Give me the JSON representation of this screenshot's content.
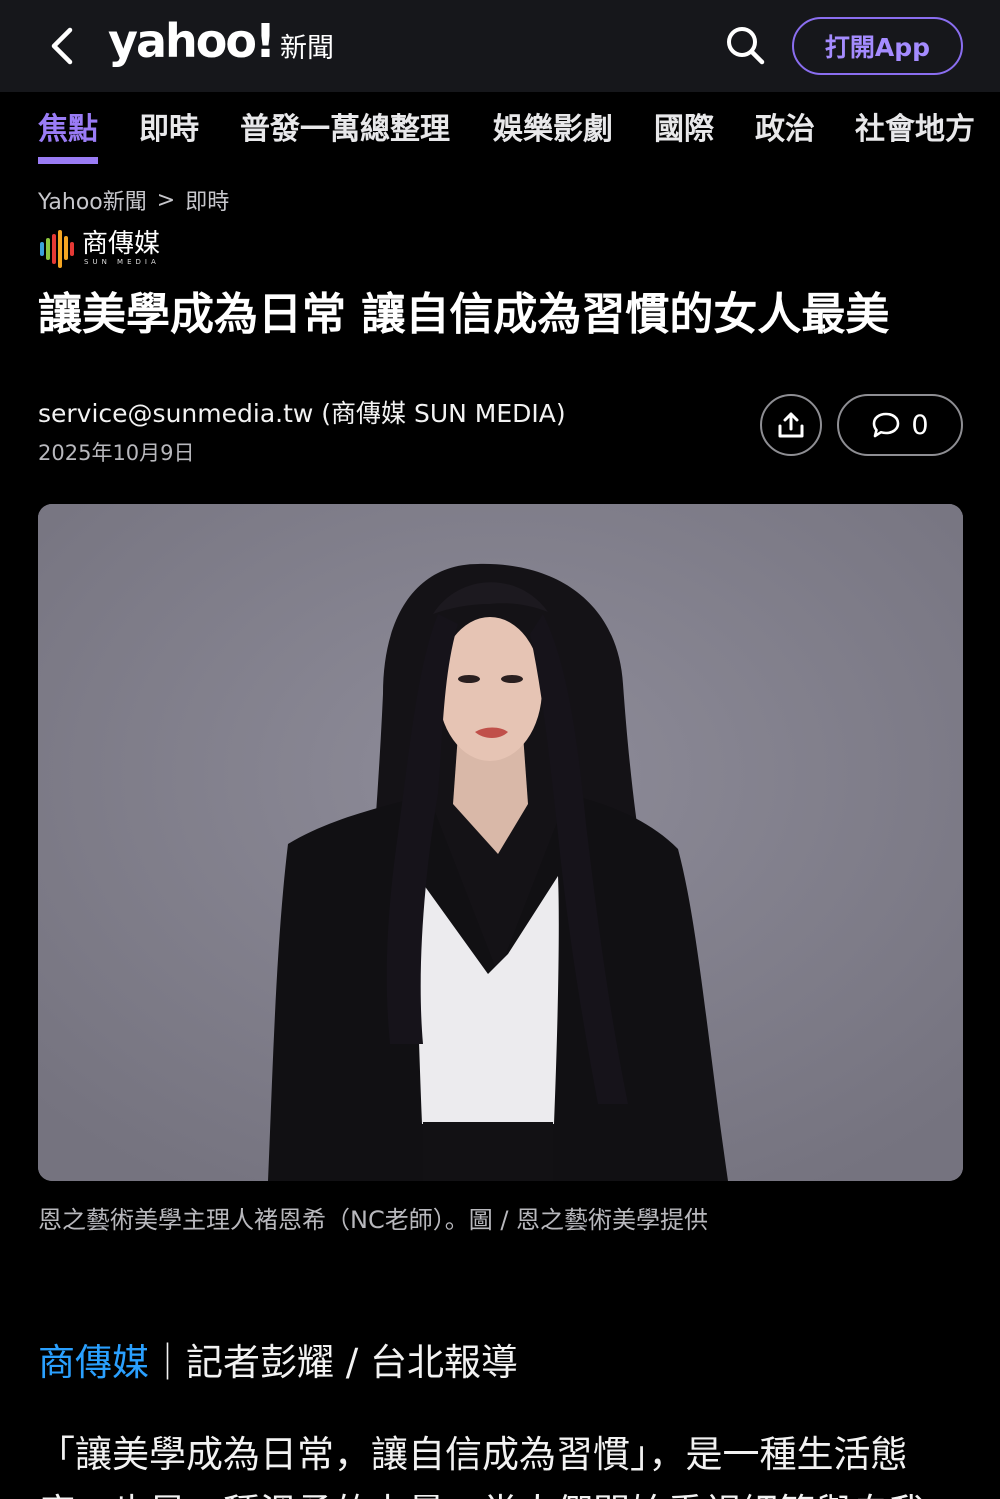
{
  "header": {
    "logo_word": "yahoo!",
    "logo_sub": "新聞",
    "open_app_label": "打開App",
    "back_icon": "chevron-left-icon",
    "search_icon": "search-icon"
  },
  "nav_tabs": [
    {
      "label": "焦點",
      "active": true
    },
    {
      "label": "即時",
      "active": false
    },
    {
      "label": "普發一萬總整理",
      "active": false
    },
    {
      "label": "娛樂影劇",
      "active": false
    },
    {
      "label": "國際",
      "active": false
    },
    {
      "label": "政治",
      "active": false
    },
    {
      "label": "社會地方",
      "active": false
    }
  ],
  "breadcrumb": {
    "home": "Yahoo新聞",
    "separator": ">",
    "current": "即時"
  },
  "source": {
    "name": "商傳媒",
    "sub": "SUN MEDIA"
  },
  "article": {
    "headline": "讓美學成為日常 讓自信成為習慣的女人最美",
    "author": "service@sunmedia.tw (商傳媒 SUN MEDIA)",
    "date": "2025年10月9日",
    "comment_count": "0",
    "photo_caption": "恩之藝術美學主理人褚恩希（NC老師）。圖 / 恩之藝術美學提供",
    "byline_source": "商傳媒",
    "byline_rest": "｜記者彭耀 / 台北報導",
    "body_first": "「讓美學成為日常，讓自信成為習慣」，是一種生活態度，也是一種溫柔的力量。當人們開始重視細節與自我"
  },
  "colors": {
    "accent": "#9a7cf5",
    "topbar_bg": "#16171b",
    "link_blue": "#2aa0ff",
    "photo_bg": "#848290"
  }
}
